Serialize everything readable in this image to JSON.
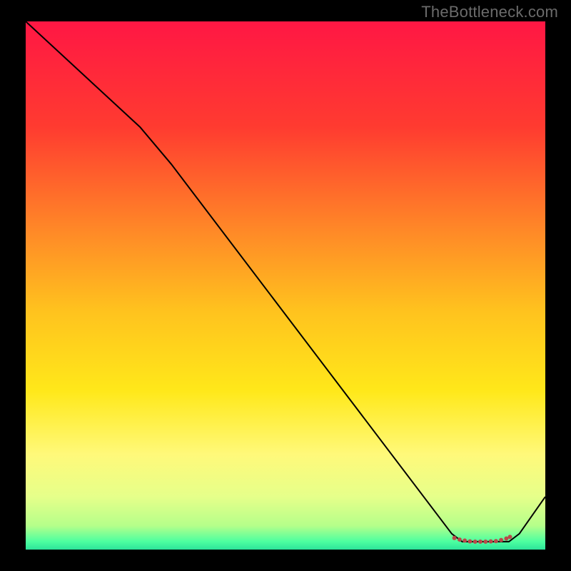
{
  "watermark": "TheBottleneck.com",
  "chart_data": {
    "type": "line",
    "title": "",
    "xlabel": "",
    "ylabel": "",
    "xlim": [
      0,
      100
    ],
    "ylim": [
      0,
      100
    ],
    "background_gradient": {
      "stops": [
        {
          "offset": 0.0,
          "color": "#ff1744"
        },
        {
          "offset": 0.2,
          "color": "#ff3b30"
        },
        {
          "offset": 0.4,
          "color": "#ff8a27"
        },
        {
          "offset": 0.55,
          "color": "#ffc31e"
        },
        {
          "offset": 0.7,
          "color": "#ffe81a"
        },
        {
          "offset": 0.82,
          "color": "#fff97a"
        },
        {
          "offset": 0.9,
          "color": "#e6ff8a"
        },
        {
          "offset": 0.955,
          "color": "#b5ff8a"
        },
        {
          "offset": 0.985,
          "color": "#4cffa0"
        },
        {
          "offset": 1.0,
          "color": "#2de39a"
        }
      ]
    },
    "series": [
      {
        "name": "bottleneck-curve",
        "color": "#000000",
        "width": 2,
        "points": [
          {
            "x": 0,
            "y": 100
          },
          {
            "x": 22,
            "y": 80
          },
          {
            "x": 28,
            "y": 73
          },
          {
            "x": 82,
            "y": 3
          },
          {
            "x": 84,
            "y": 1.5
          },
          {
            "x": 93,
            "y": 1.5
          },
          {
            "x": 95,
            "y": 3
          },
          {
            "x": 100,
            "y": 10
          }
        ]
      }
    ],
    "markers": {
      "name": "optimal-range",
      "color": "#b94a4a",
      "size": 6,
      "points": [
        {
          "x": 82.5,
          "y": 2.2
        },
        {
          "x": 83.5,
          "y": 1.9
        },
        {
          "x": 84.5,
          "y": 1.7
        },
        {
          "x": 85.5,
          "y": 1.55
        },
        {
          "x": 86.5,
          "y": 1.5
        },
        {
          "x": 87.5,
          "y": 1.5
        },
        {
          "x": 88.5,
          "y": 1.5
        },
        {
          "x": 89.5,
          "y": 1.55
        },
        {
          "x": 90.5,
          "y": 1.6
        },
        {
          "x": 91.5,
          "y": 1.8
        },
        {
          "x": 92.5,
          "y": 2.1
        },
        {
          "x": 93.2,
          "y": 2.4
        }
      ]
    }
  }
}
